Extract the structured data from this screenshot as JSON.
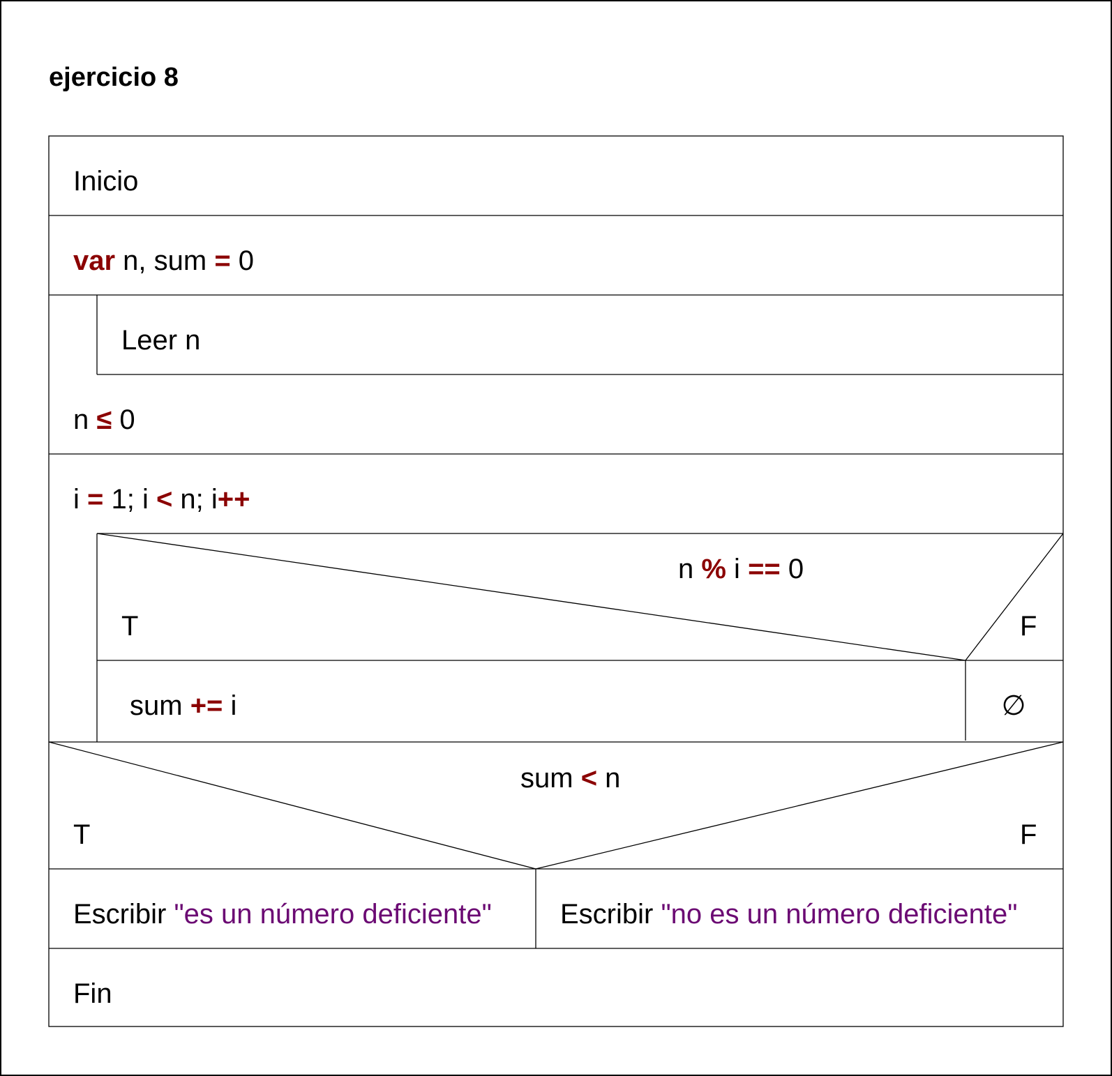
{
  "title": "ejercicio 8",
  "colors": {
    "keyword": "#8b0000",
    "string": "#6b0a73",
    "text": "#000000"
  },
  "blocks": {
    "start": "Inicio",
    "declare": {
      "keyword": "var",
      "vars": " n, sum ",
      "op": "=",
      "value": " 0"
    },
    "read": "Leer n",
    "loop_condition": {
      "a": "n ",
      "op": "≤",
      "b": " 0"
    },
    "for_header": {
      "p1": "i ",
      "op1": "=",
      "p2": " 1; i ",
      "op2": "<",
      "p3": " n; i",
      "op3": "++"
    },
    "inner_if": {
      "condition": {
        "a": "n ",
        "op1": "%",
        "b": " i ",
        "op2": "==",
        "c": " 0"
      },
      "true_label": "T",
      "false_label": "F",
      "true_action": {
        "a": "sum ",
        "op": "+=",
        "b": " i"
      },
      "false_action": "∅"
    },
    "outer_if": {
      "condition": {
        "a": "sum ",
        "op": "<",
        "b": " n"
      },
      "true_label": "T",
      "false_label": "F",
      "true_action": {
        "cmd": "Escribir ",
        "string": "\"es un número deficiente\""
      },
      "false_action": {
        "cmd": "Escribir ",
        "string": "\"no es un número deficiente\""
      }
    },
    "end": "Fin"
  }
}
